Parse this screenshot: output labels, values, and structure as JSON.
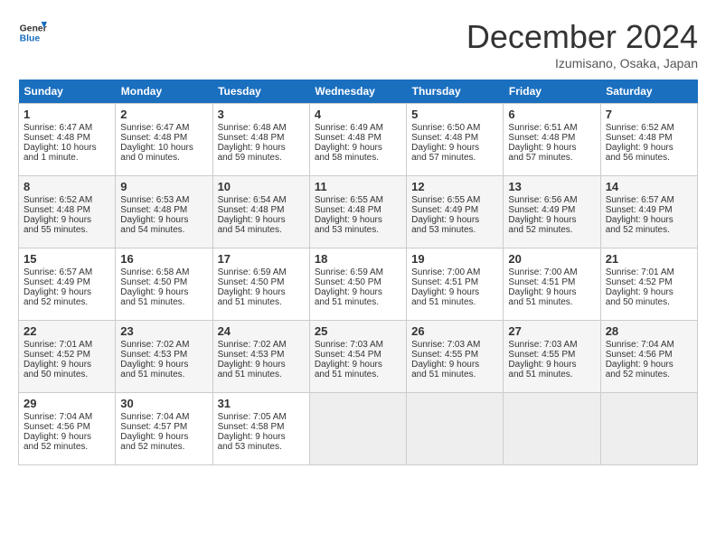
{
  "logo": {
    "line1": "General",
    "line2": "Blue"
  },
  "title": "December 2024",
  "subtitle": "Izumisano, Osaka, Japan",
  "days_of_week": [
    "Sunday",
    "Monday",
    "Tuesday",
    "Wednesday",
    "Thursday",
    "Friday",
    "Saturday"
  ],
  "weeks": [
    [
      {
        "day": "1",
        "info": "Sunrise: 6:47 AM\nSunset: 4:48 PM\nDaylight: 10 hours\nand 1 minute."
      },
      {
        "day": "2",
        "info": "Sunrise: 6:47 AM\nSunset: 4:48 PM\nDaylight: 10 hours\nand 0 minutes."
      },
      {
        "day": "3",
        "info": "Sunrise: 6:48 AM\nSunset: 4:48 PM\nDaylight: 9 hours\nand 59 minutes."
      },
      {
        "day": "4",
        "info": "Sunrise: 6:49 AM\nSunset: 4:48 PM\nDaylight: 9 hours\nand 58 minutes."
      },
      {
        "day": "5",
        "info": "Sunrise: 6:50 AM\nSunset: 4:48 PM\nDaylight: 9 hours\nand 57 minutes."
      },
      {
        "day": "6",
        "info": "Sunrise: 6:51 AM\nSunset: 4:48 PM\nDaylight: 9 hours\nand 57 minutes."
      },
      {
        "day": "7",
        "info": "Sunrise: 6:52 AM\nSunset: 4:48 PM\nDaylight: 9 hours\nand 56 minutes."
      }
    ],
    [
      {
        "day": "8",
        "info": "Sunrise: 6:52 AM\nSunset: 4:48 PM\nDaylight: 9 hours\nand 55 minutes."
      },
      {
        "day": "9",
        "info": "Sunrise: 6:53 AM\nSunset: 4:48 PM\nDaylight: 9 hours\nand 54 minutes."
      },
      {
        "day": "10",
        "info": "Sunrise: 6:54 AM\nSunset: 4:48 PM\nDaylight: 9 hours\nand 54 minutes."
      },
      {
        "day": "11",
        "info": "Sunrise: 6:55 AM\nSunset: 4:48 PM\nDaylight: 9 hours\nand 53 minutes."
      },
      {
        "day": "12",
        "info": "Sunrise: 6:55 AM\nSunset: 4:49 PM\nDaylight: 9 hours\nand 53 minutes."
      },
      {
        "day": "13",
        "info": "Sunrise: 6:56 AM\nSunset: 4:49 PM\nDaylight: 9 hours\nand 52 minutes."
      },
      {
        "day": "14",
        "info": "Sunrise: 6:57 AM\nSunset: 4:49 PM\nDaylight: 9 hours\nand 52 minutes."
      }
    ],
    [
      {
        "day": "15",
        "info": "Sunrise: 6:57 AM\nSunset: 4:49 PM\nDaylight: 9 hours\nand 52 minutes."
      },
      {
        "day": "16",
        "info": "Sunrise: 6:58 AM\nSunset: 4:50 PM\nDaylight: 9 hours\nand 51 minutes."
      },
      {
        "day": "17",
        "info": "Sunrise: 6:59 AM\nSunset: 4:50 PM\nDaylight: 9 hours\nand 51 minutes."
      },
      {
        "day": "18",
        "info": "Sunrise: 6:59 AM\nSunset: 4:50 PM\nDaylight: 9 hours\nand 51 minutes."
      },
      {
        "day": "19",
        "info": "Sunrise: 7:00 AM\nSunset: 4:51 PM\nDaylight: 9 hours\nand 51 minutes."
      },
      {
        "day": "20",
        "info": "Sunrise: 7:00 AM\nSunset: 4:51 PM\nDaylight: 9 hours\nand 51 minutes."
      },
      {
        "day": "21",
        "info": "Sunrise: 7:01 AM\nSunset: 4:52 PM\nDaylight: 9 hours\nand 50 minutes."
      }
    ],
    [
      {
        "day": "22",
        "info": "Sunrise: 7:01 AM\nSunset: 4:52 PM\nDaylight: 9 hours\nand 50 minutes."
      },
      {
        "day": "23",
        "info": "Sunrise: 7:02 AM\nSunset: 4:53 PM\nDaylight: 9 hours\nand 51 minutes."
      },
      {
        "day": "24",
        "info": "Sunrise: 7:02 AM\nSunset: 4:53 PM\nDaylight: 9 hours\nand 51 minutes."
      },
      {
        "day": "25",
        "info": "Sunrise: 7:03 AM\nSunset: 4:54 PM\nDaylight: 9 hours\nand 51 minutes."
      },
      {
        "day": "26",
        "info": "Sunrise: 7:03 AM\nSunset: 4:55 PM\nDaylight: 9 hours\nand 51 minutes."
      },
      {
        "day": "27",
        "info": "Sunrise: 7:03 AM\nSunset: 4:55 PM\nDaylight: 9 hours\nand 51 minutes."
      },
      {
        "day": "28",
        "info": "Sunrise: 7:04 AM\nSunset: 4:56 PM\nDaylight: 9 hours\nand 52 minutes."
      }
    ],
    [
      {
        "day": "29",
        "info": "Sunrise: 7:04 AM\nSunset: 4:56 PM\nDaylight: 9 hours\nand 52 minutes."
      },
      {
        "day": "30",
        "info": "Sunrise: 7:04 AM\nSunset: 4:57 PM\nDaylight: 9 hours\nand 52 minutes."
      },
      {
        "day": "31",
        "info": "Sunrise: 7:05 AM\nSunset: 4:58 PM\nDaylight: 9 hours\nand 53 minutes."
      },
      {
        "day": "",
        "info": ""
      },
      {
        "day": "",
        "info": ""
      },
      {
        "day": "",
        "info": ""
      },
      {
        "day": "",
        "info": ""
      }
    ]
  ]
}
